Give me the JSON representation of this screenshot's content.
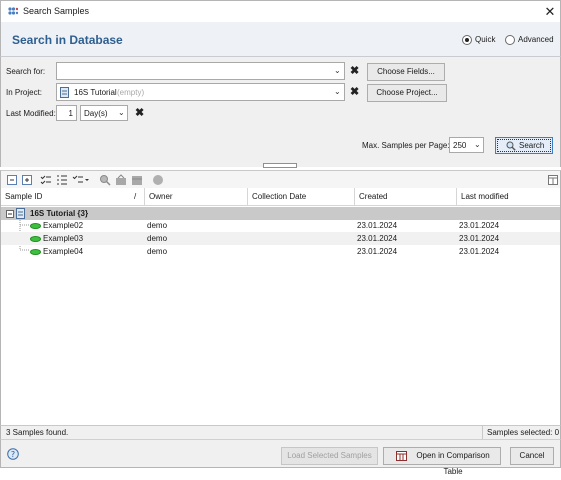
{
  "window": {
    "title": "Search Samples",
    "close_icon": "close-icon"
  },
  "header": {
    "title": "Search in Database",
    "modes": [
      {
        "label": "Quick",
        "selected": true
      },
      {
        "label": "Advanced",
        "selected": false
      }
    ]
  },
  "form": {
    "search_for_label": "Search for:",
    "search_for_value": "",
    "choose_fields_label": "Choose Fields...",
    "in_project_label": "In Project:",
    "project_name": "16S Tutorial",
    "project_hint": "(empty)",
    "choose_project_label": "Choose Project...",
    "last_modified_label": "Last Modified:",
    "last_modified_value": "1",
    "last_modified_unit": "Day(s)",
    "max_samples_label": "Max. Samples per Page:",
    "max_samples_value": "250",
    "search_label": "Search"
  },
  "table": {
    "columns": [
      "Sample ID",
      "Owner",
      "Collection Date",
      "Created",
      "Last modified"
    ],
    "sort_indicator": "/",
    "group": {
      "label": "16S Tutorial {3}"
    },
    "rows": [
      {
        "id": "Example02",
        "owner": "demo",
        "collection_date": "",
        "created": "23.01.2024",
        "last_modified": "23.01.2024"
      },
      {
        "id": "Example03",
        "owner": "demo",
        "collection_date": "",
        "created": "23.01.2024",
        "last_modified": "23.01.2024"
      },
      {
        "id": "Example04",
        "owner": "demo",
        "collection_date": "",
        "created": "23.01.2024",
        "last_modified": "23.01.2024"
      }
    ]
  },
  "status": {
    "found": "3 Samples found.",
    "selected": "Samples selected:  0"
  },
  "footer": {
    "load_label": "Load Selected Samples",
    "open_label": "Open in Comparison Table",
    "cancel_label": "Cancel"
  },
  "colors": {
    "accent": "#2e5f8f",
    "focus": "#3c7fc3",
    "group_row": "#c9c9c9",
    "sample_icon": "#3fbf3f"
  }
}
